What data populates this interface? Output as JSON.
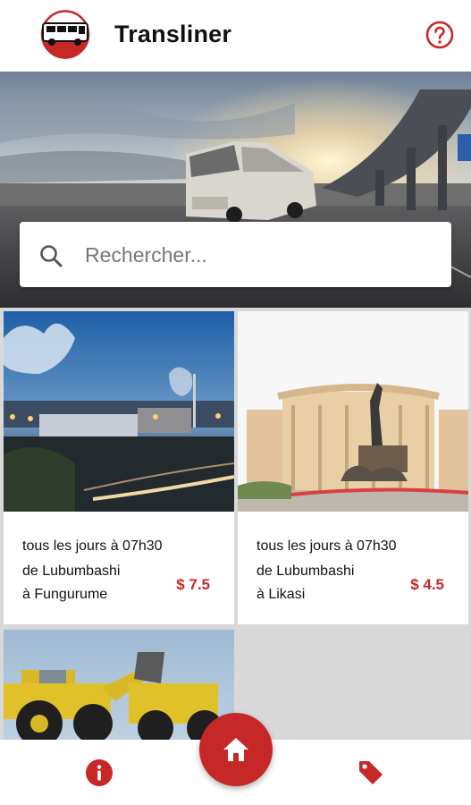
{
  "app": {
    "title": "Transliner",
    "brand_color": "#c62828"
  },
  "header": {
    "logo_icon": "bus-logo-icon",
    "help_icon": "help-circle-icon"
  },
  "search": {
    "placeholder": "Rechercher...",
    "icon": "search-icon"
  },
  "routes": [
    {
      "schedule": "tous les jours à 07h30",
      "from": "de Lubumbashi",
      "to": "à Fungurume",
      "price": "$ 7.5",
      "image": "city-night-photo"
    },
    {
      "schedule": "tous les jours à 07h30",
      "from": "de Lubumbashi",
      "to": "à Likasi",
      "price": "$ 4.5",
      "image": "hotel-monument-photo"
    },
    {
      "image": "mining-loader-photo"
    }
  ],
  "bottom_nav": {
    "left_icon": "info-icon",
    "center_icon": "home-icon",
    "right_icon": "price-tag-icon"
  }
}
